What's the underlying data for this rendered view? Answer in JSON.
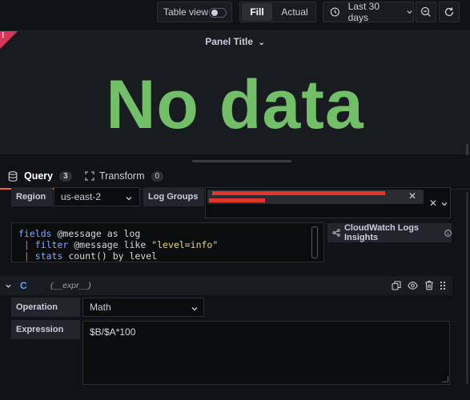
{
  "toolbar": {
    "table_view_label": "Table view",
    "fill_label": "Fill",
    "actual_label": "Actual",
    "time_range": "Last 30 days"
  },
  "panel": {
    "title": "Panel Title",
    "warning_mark": "!",
    "no_data_text": "No data"
  },
  "tabs": [
    {
      "label": "Query",
      "count": "3",
      "active": true
    },
    {
      "label": "Transform",
      "count": "0",
      "active": false
    }
  ],
  "query_a": {
    "region_label": "Region",
    "region_value": "us-east-2",
    "log_groups_label": "Log Groups",
    "query_lines": [
      {
        "kw": "fields",
        "rest": " @message as log"
      },
      {
        "pipe": " | ",
        "kw": "filter",
        "rest": " @message like ",
        "str": "\"level=info\""
      },
      {
        "pipe": " | ",
        "kw": "stats",
        "rest": " count() by level"
      }
    ],
    "insights_link": "CloudWatch Logs Insights"
  },
  "query_c": {
    "ref_id": "C",
    "datasource": "(__expr__)",
    "operation_label": "Operation",
    "operation_value": "Math",
    "expression_label": "Expression",
    "expression_value": "$B/$A*100"
  },
  "colors": {
    "accent_green": "#73bf69",
    "tab_active_underline": "#f55f3e",
    "error_corner": "#d8375a",
    "query_ref_blue": "#6e9fff"
  }
}
